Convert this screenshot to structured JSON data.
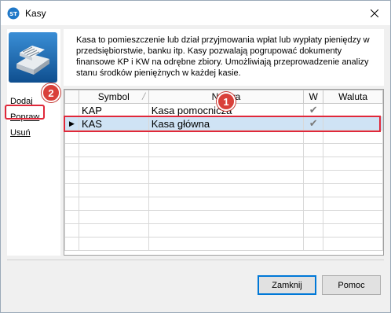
{
  "window": {
    "title": "Kasy"
  },
  "sidebar": {
    "links": [
      {
        "label": "Dodaj"
      },
      {
        "label": "Popraw"
      },
      {
        "label": "Usuń"
      }
    ]
  },
  "description": "Kasa to pomieszczenie lub dział przyjmowania wpłat lub wypłaty pieniędzy w przedsiębiorstwie, banku itp. Kasy pozwalają pogrupować dokumenty finansowe KP i KW na odrębne zbiory. Umożliwiają przeprowadzenie analizy stanu środków pieniężnych w każdej kasie.",
  "grid": {
    "columns": [
      "Symbol",
      "Nazwa",
      "W",
      "Waluta"
    ],
    "rows": [
      {
        "symbol": "KAP",
        "name": "Kasa pomocnicza",
        "w": "✔",
        "currency": "",
        "selected": false
      },
      {
        "symbol": "KAS",
        "name": "Kasa główna",
        "w": "✔",
        "currency": "",
        "selected": true
      }
    ],
    "current_row_indicator": "▶"
  },
  "annotations": {
    "badge_1": "1",
    "badge_2": "2"
  },
  "buttons": {
    "close": "Zamknij",
    "help": "Pomoc"
  },
  "colors": {
    "highlight_border": "#e0283a",
    "selected_row": "#cfe3f5",
    "badge": "#d9403a"
  }
}
